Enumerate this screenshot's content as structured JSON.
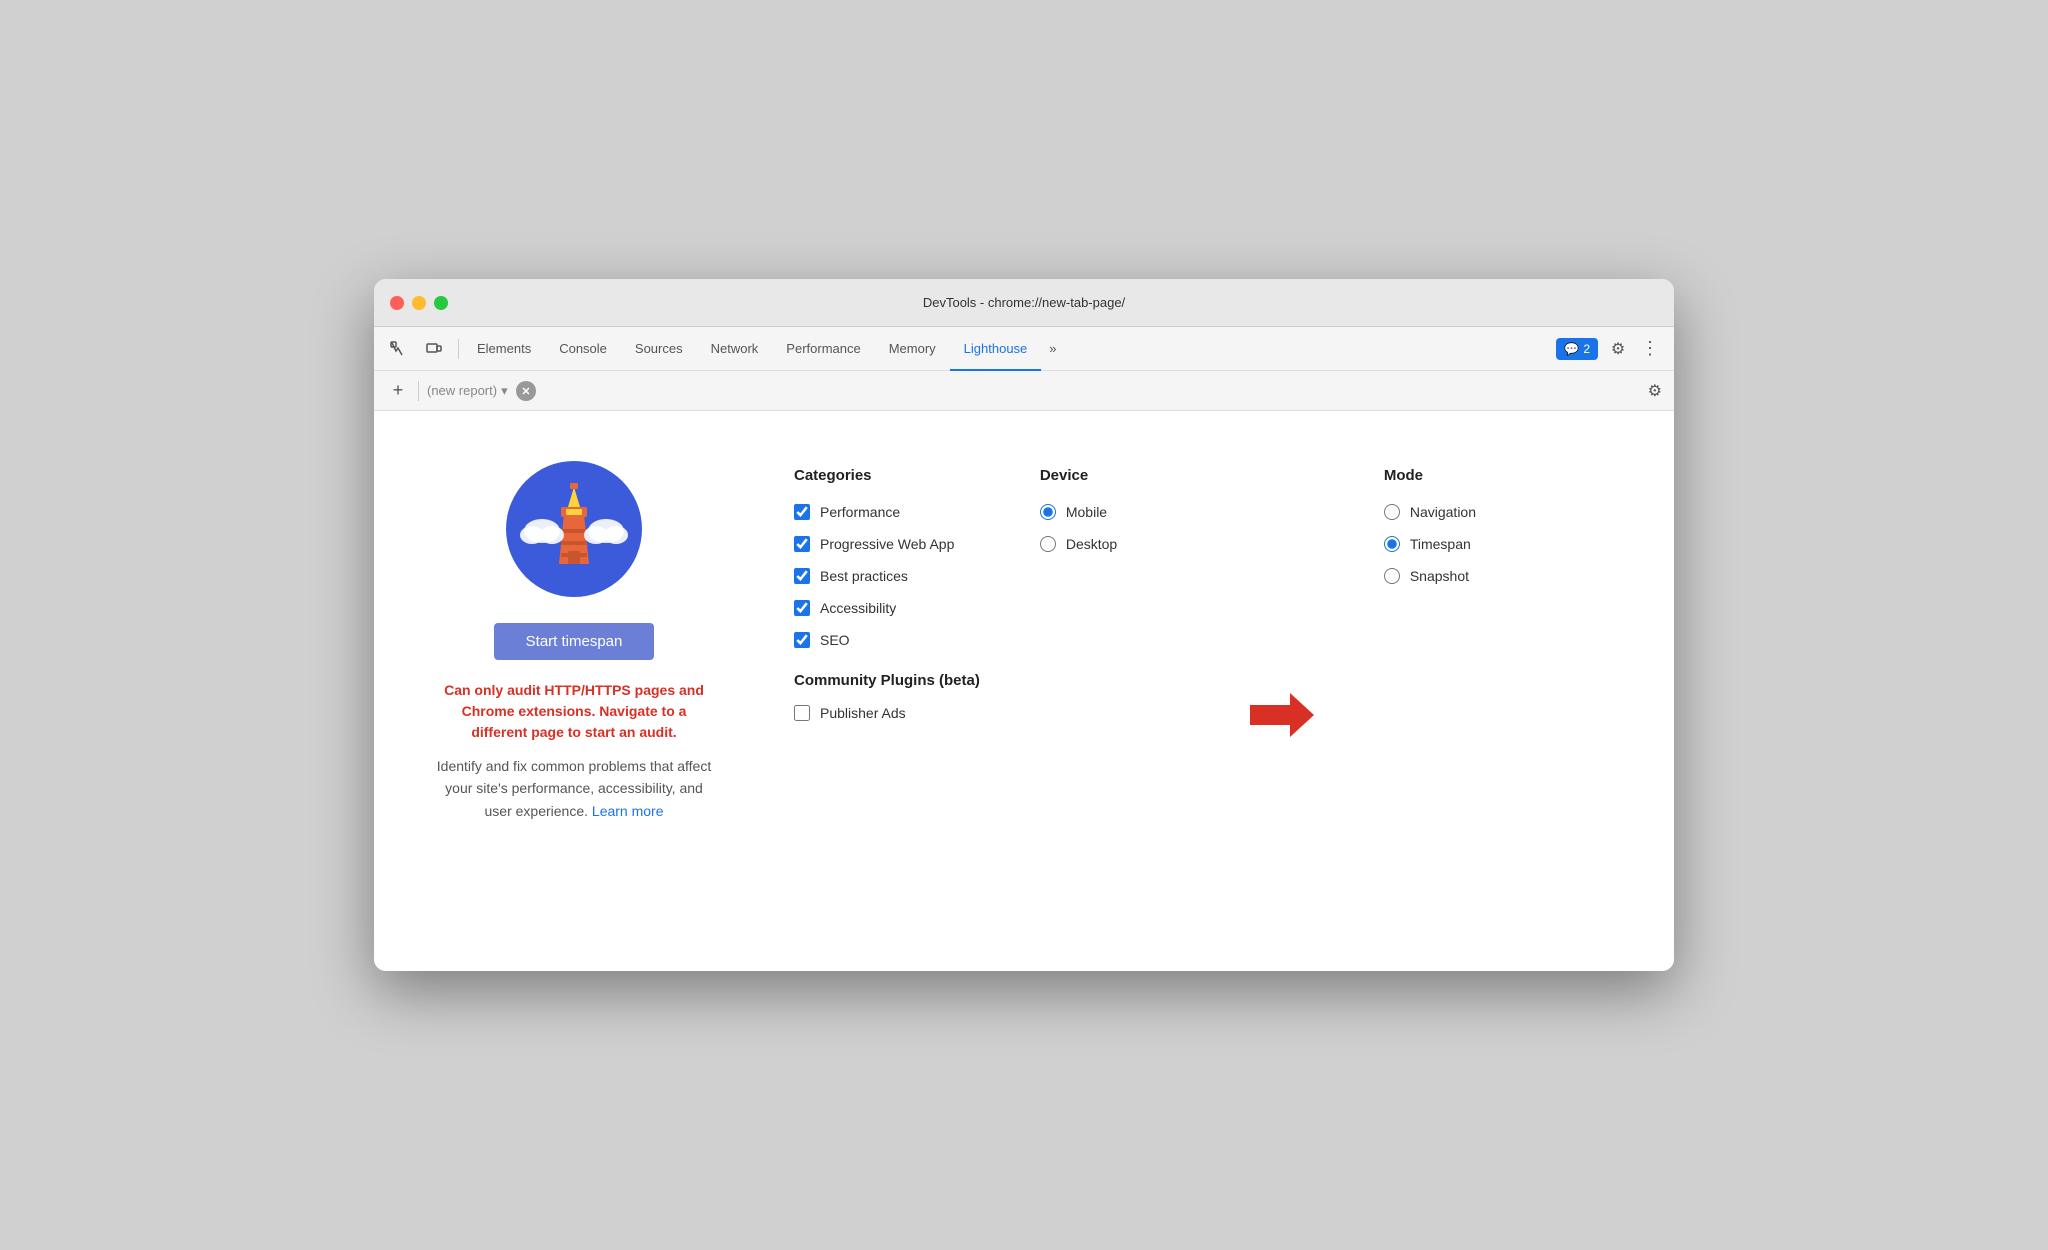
{
  "window": {
    "title": "DevTools - chrome://new-tab-page/"
  },
  "tabs": {
    "items": [
      {
        "label": "Elements",
        "active": false
      },
      {
        "label": "Console",
        "active": false
      },
      {
        "label": "Sources",
        "active": false
      },
      {
        "label": "Network",
        "active": false
      },
      {
        "label": "Performance",
        "active": false
      },
      {
        "label": "Memory",
        "active": false
      },
      {
        "label": "Lighthouse",
        "active": true
      }
    ],
    "more_label": "»",
    "notifications_count": "2",
    "settings_icon": "⚙",
    "more_icon": "⋮"
  },
  "report_bar": {
    "add_icon": "+",
    "select_label": "(new report)",
    "gear_icon": "⚙"
  },
  "left_panel": {
    "start_button": "Start timespan",
    "warning_text": "Can only audit HTTP/HTTPS pages and Chrome extensions. Navigate to a different page to start an audit.",
    "description": "Identify and fix common problems that affect your site's performance, accessibility, and user experience.",
    "learn_more": "Learn more"
  },
  "categories": {
    "title": "Categories",
    "items": [
      {
        "label": "Performance",
        "checked": true
      },
      {
        "label": "Progressive Web App",
        "checked": true
      },
      {
        "label": "Best practices",
        "checked": true
      },
      {
        "label": "Accessibility",
        "checked": true
      },
      {
        "label": "SEO",
        "checked": true
      }
    ]
  },
  "community_plugins": {
    "title": "Community Plugins (beta)",
    "items": [
      {
        "label": "Publisher Ads",
        "checked": false
      }
    ]
  },
  "device": {
    "title": "Device",
    "options": [
      {
        "label": "Mobile",
        "selected": true
      },
      {
        "label": "Desktop",
        "selected": false
      }
    ]
  },
  "mode": {
    "title": "Mode",
    "options": [
      {
        "label": "Navigation",
        "selected": false
      },
      {
        "label": "Timespan",
        "selected": true
      },
      {
        "label": "Snapshot",
        "selected": false
      }
    ]
  },
  "colors": {
    "accent": "#1a73e8",
    "warning_red": "#d93025",
    "start_btn": "#6b7fd7"
  }
}
